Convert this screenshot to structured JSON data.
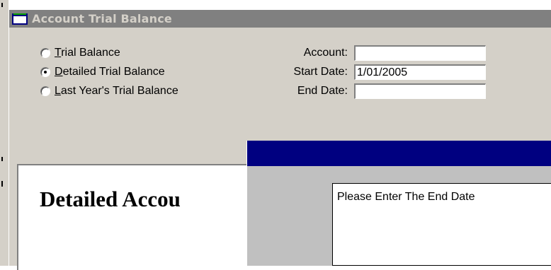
{
  "window": {
    "title": "Account Trial Balance"
  },
  "options": [
    {
      "accel": "T",
      "rest": "rial Balance",
      "checked": false
    },
    {
      "accel": "D",
      "rest": "etailed Trial Balance",
      "checked": true
    },
    {
      "accel": "L",
      "rest": "ast Year's Trial Balance",
      "checked": false
    }
  ],
  "fields": {
    "account": {
      "label": "Account:",
      "value": ""
    },
    "start_date": {
      "label": "Start Date:",
      "value": "1/01/2005"
    },
    "end_date": {
      "label": "End Date:",
      "value": ""
    }
  },
  "report": {
    "title": "Detailed Accou"
  },
  "dialog": {
    "message": "Please Enter The End Date"
  }
}
